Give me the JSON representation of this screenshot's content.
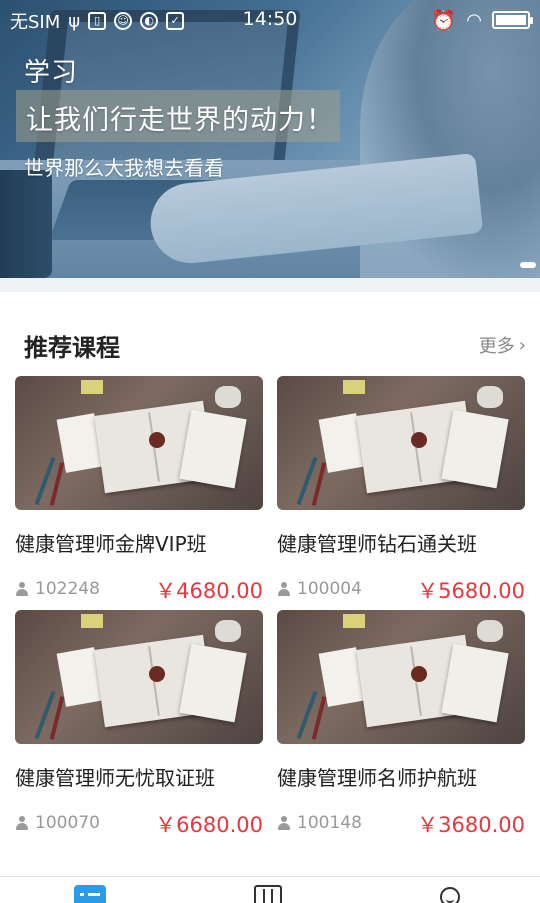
{
  "status_bar": {
    "carrier": "无SIM",
    "time": "14:50"
  },
  "banner": {
    "title": "学习",
    "slogan": "让我们行走世界的动力！",
    "subtitle": "世界那么大我想去看看"
  },
  "section": {
    "title": "推荐课程",
    "more_label": "更多"
  },
  "courses": [
    {
      "name": "健康管理师金牌VIP班",
      "students": "102248",
      "price": "￥4680.00"
    },
    {
      "name": "健康管理师钻石通关班",
      "students": "100004",
      "price": "￥5680.00"
    },
    {
      "name": "健康管理师无忧取证班",
      "students": "100070",
      "price": "￥6680.00"
    },
    {
      "name": "健康管理师名师护航班",
      "students": "100148",
      "price": "￥3680.00"
    }
  ],
  "colors": {
    "accent": "#2a9be6",
    "price": "#e4383e"
  },
  "tabbar": {
    "icons": [
      "home-icon",
      "course-book-icon",
      "profile-icon"
    ]
  }
}
